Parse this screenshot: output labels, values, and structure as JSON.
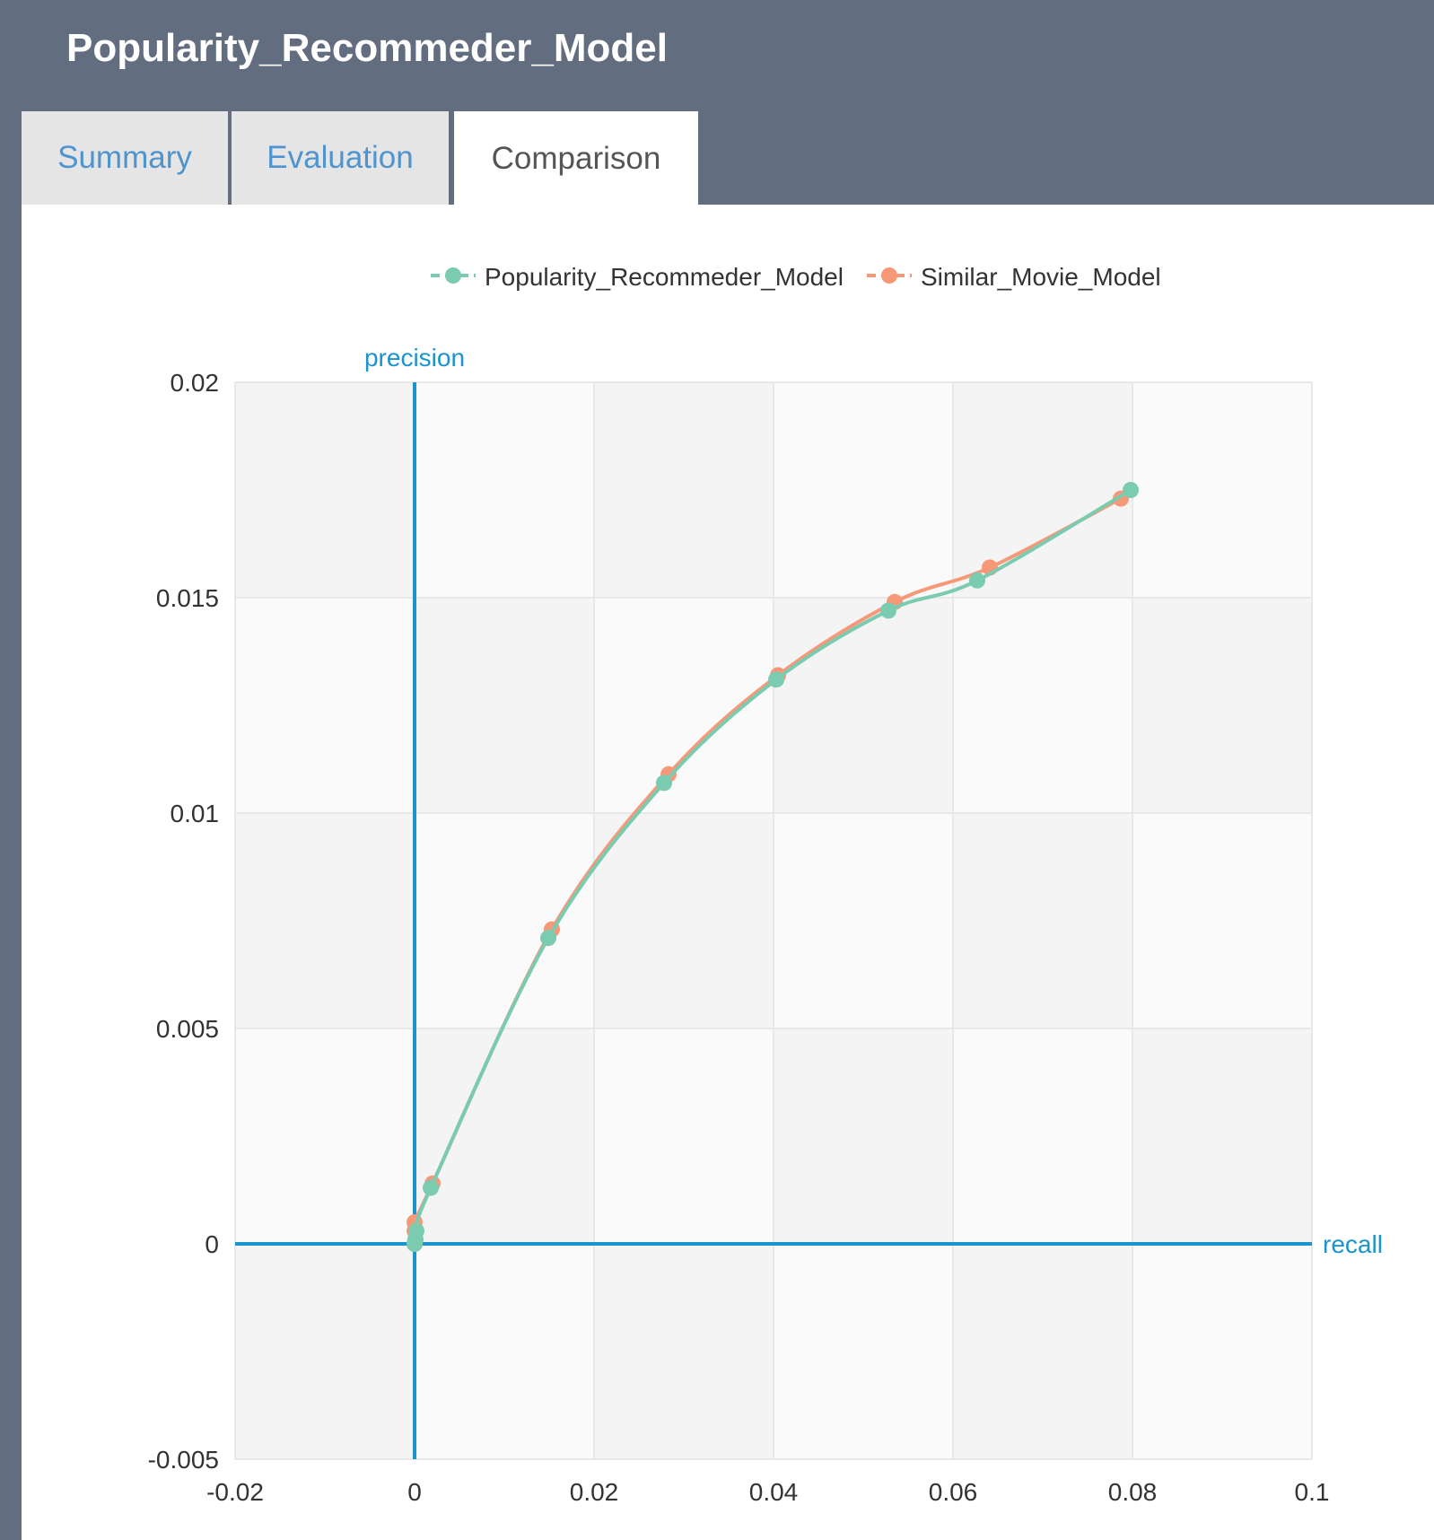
{
  "app": {
    "title": "Popularity_Recommeder_Model"
  },
  "tabs": [
    {
      "label": "Summary",
      "active": false
    },
    {
      "label": "Evaluation",
      "active": false
    },
    {
      "label": "Comparison",
      "active": true
    }
  ],
  "colors": {
    "header_bg": "#626e80",
    "tab_inactive_bg": "#e5e5e5",
    "tab_inactive_text": "#4f93cf",
    "tab_active_text": "#555555",
    "axis": "#1b93cf",
    "band_dark": "#f4f4f4",
    "band_light": "#fafafa",
    "grid": "#e8e8e8"
  },
  "chart_data": {
    "type": "line",
    "xlabel": "recall",
    "ylabel": "precision",
    "xlim": [
      -0.02,
      0.1
    ],
    "ylim": [
      -0.005,
      0.02
    ],
    "x_ticks": [
      "-0.02",
      "0",
      "0.02",
      "0.04",
      "0.06",
      "0.08",
      "0.1"
    ],
    "y_ticks": [
      "-0.005",
      "0",
      "0.005",
      "0.01",
      "0.015",
      "0.02"
    ],
    "x_tick_values": [
      -0.02,
      0,
      0.02,
      0.04,
      0.06,
      0.08,
      0.1
    ],
    "y_tick_values": [
      -0.005,
      0,
      0.005,
      0.01,
      0.015,
      0.02
    ],
    "legend_position": "top",
    "grid": true,
    "series": [
      {
        "name": "Popularity_Recommeder_Model",
        "color": "#7acbaf",
        "points": [
          [
            0.0,
            0.0
          ],
          [
            0.0001,
            0.0001
          ],
          [
            0.0002,
            0.0003
          ],
          [
            0.0018,
            0.0013
          ],
          [
            0.0149,
            0.0071
          ],
          [
            0.0278,
            0.0107
          ],
          [
            0.0403,
            0.0131
          ],
          [
            0.0528,
            0.0147
          ],
          [
            0.0627,
            0.0154
          ],
          [
            0.0798,
            0.0175
          ]
        ]
      },
      {
        "name": "Similar_Movie_Model",
        "color": "#f79879",
        "points": [
          [
            0.0,
            0.0
          ],
          [
            0.0,
            0.0005
          ],
          [
            0.0,
            0.0003
          ],
          [
            0.002,
            0.0014
          ],
          [
            0.0153,
            0.0073
          ],
          [
            0.0283,
            0.0109
          ],
          [
            0.0405,
            0.0132
          ],
          [
            0.0535,
            0.0149
          ],
          [
            0.0641,
            0.0157
          ],
          [
            0.0787,
            0.0173
          ]
        ]
      }
    ]
  }
}
